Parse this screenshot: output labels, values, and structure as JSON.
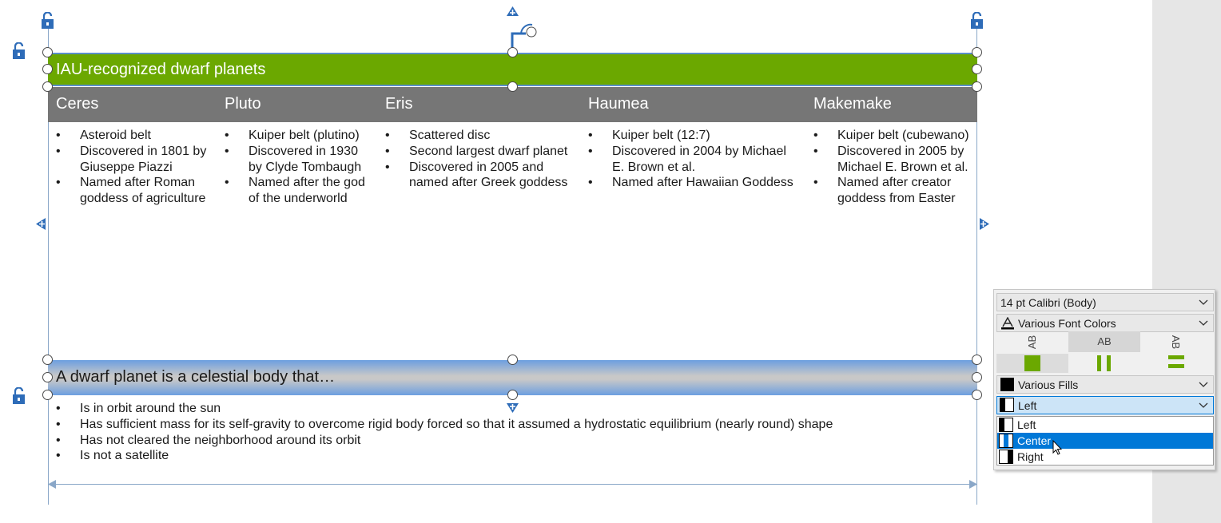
{
  "slide": {
    "top_title": "IAU-recognized dwarf planets",
    "columns": [
      {
        "title": "Ceres",
        "bullets": [
          [
            "Asteroid belt"
          ],
          [
            "Discovered in 1801 by",
            "Giuseppe Piazzi"
          ],
          [
            "Named after Roman",
            "goddess of agriculture"
          ]
        ]
      },
      {
        "title": "Pluto",
        "bullets": [
          [
            "Kuiper belt (plutino)"
          ],
          [
            "Discovered in 1930",
            "by Clyde Tombaugh"
          ],
          [
            "Named after the god",
            "of the underworld"
          ]
        ]
      },
      {
        "title": "Eris",
        "bullets": [
          [
            "Scattered disc"
          ],
          [
            "Second largest dwarf planet"
          ],
          [
            "Discovered in 2005 and",
            "named after Greek goddess"
          ]
        ]
      },
      {
        "title": "Haumea",
        "bullets": [
          [
            "Kuiper belt (12:7)"
          ],
          [
            "Discovered in 2004 by Michael",
            "E. Brown et al."
          ],
          [
            "Named after Hawaiian Goddess"
          ]
        ]
      },
      {
        "title": "Makemake",
        "bullets": [
          [
            "Kuiper belt (cubewano)"
          ],
          [
            "Discovered in 2005 by",
            "Michael E. Brown et al."
          ],
          [
            "Named after creator",
            "goddess from Easter"
          ]
        ]
      }
    ],
    "definition_title": "A dwarf planet is a celestial body that…",
    "definition_bullets": [
      "Is in orbit around the sun",
      "Has sufficient mass for its self-gravity to overcome rigid body forced so that it assumed a hydrostatic equilibrium (nearly round) shape",
      "Has not cleared the neighborhood around its orbit",
      "Is not a satellite"
    ]
  },
  "colors": {
    "title_bar": "#6ba800",
    "column_header_bar": "#767676",
    "definition_bar_edge": "#6c9fe0",
    "selection_blue": "#0078d7"
  },
  "format_panel": {
    "font": "14 pt Calibri (Body)",
    "font_color": "Various Font Colors",
    "text_direction_labels": [
      "AB",
      "AB",
      "AB"
    ],
    "fill": "Various Fills",
    "alignment_selected": "Left",
    "alignment_options": [
      "Left",
      "Center",
      "Right"
    ],
    "highlighted_option": "Center"
  }
}
